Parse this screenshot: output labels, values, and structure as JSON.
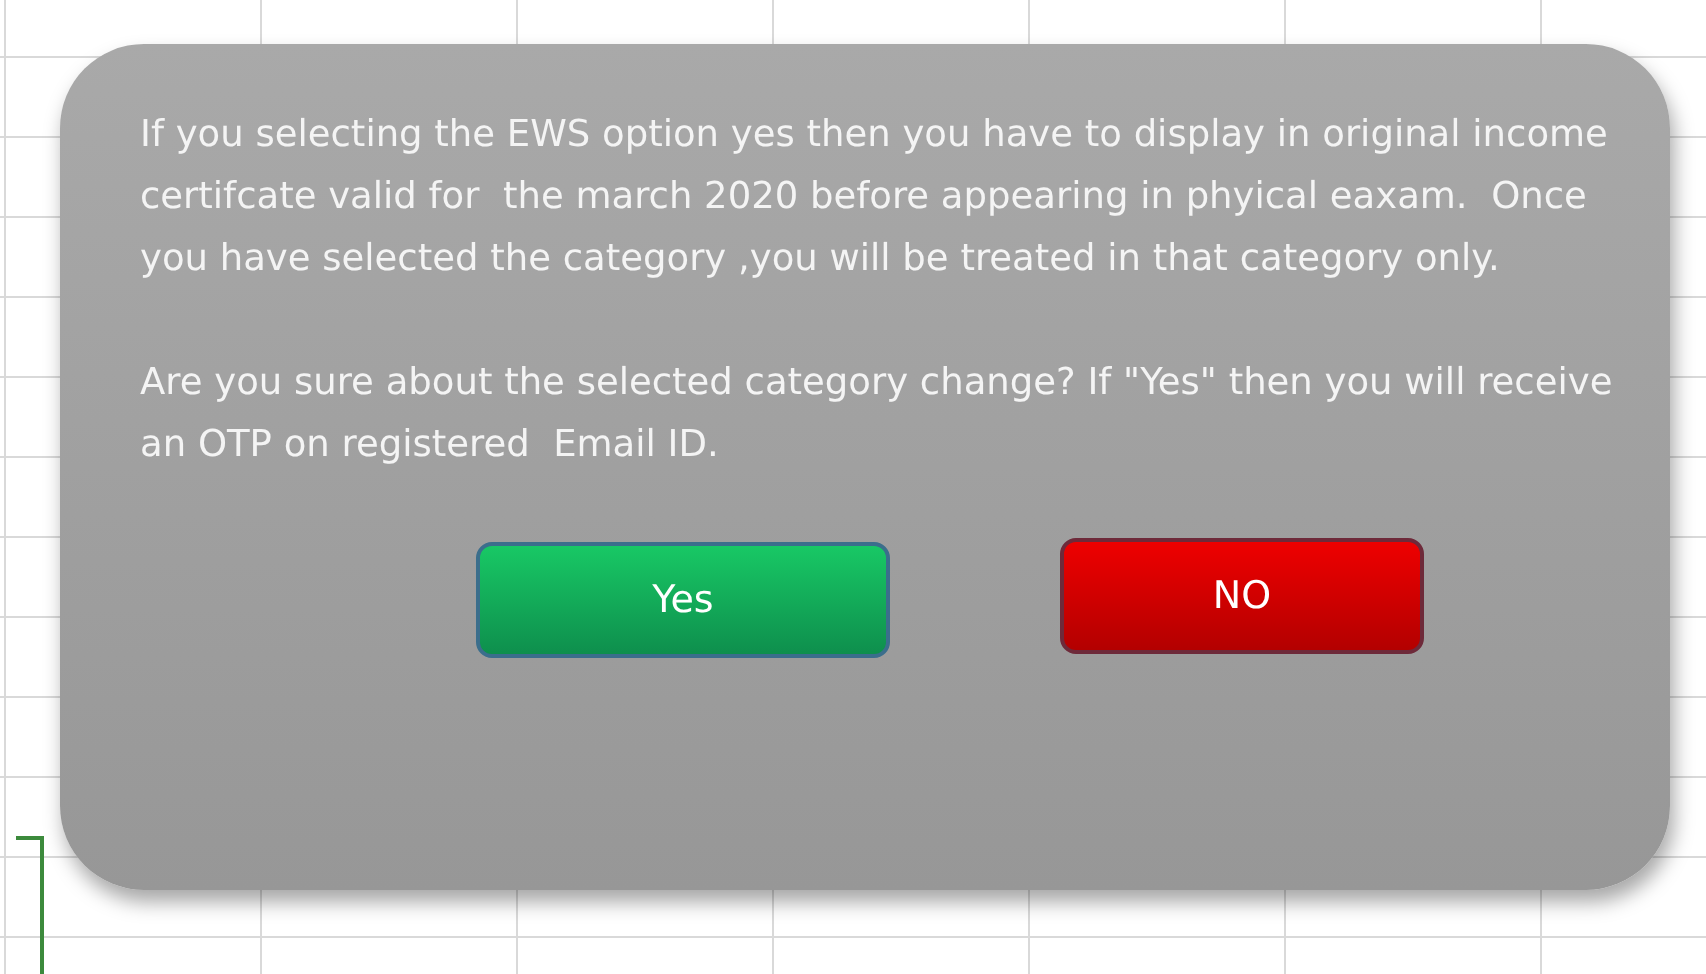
{
  "dialog": {
    "paragraphs": [
      "If you selecting the EWS option yes then you have to display in original income certifcate valid for  the march 2020 before appearing in phyical eaxam.  Once you have selected the category ,you will be treated in that category only.",
      "Are you sure about the selected category change? If \"Yes\" then you will receive an OTP on registered  Email ID."
    ],
    "buttons": [
      {
        "label": "Yes",
        "kind": "confirm"
      },
      {
        "label": "NO",
        "kind": "cancel"
      }
    ]
  }
}
